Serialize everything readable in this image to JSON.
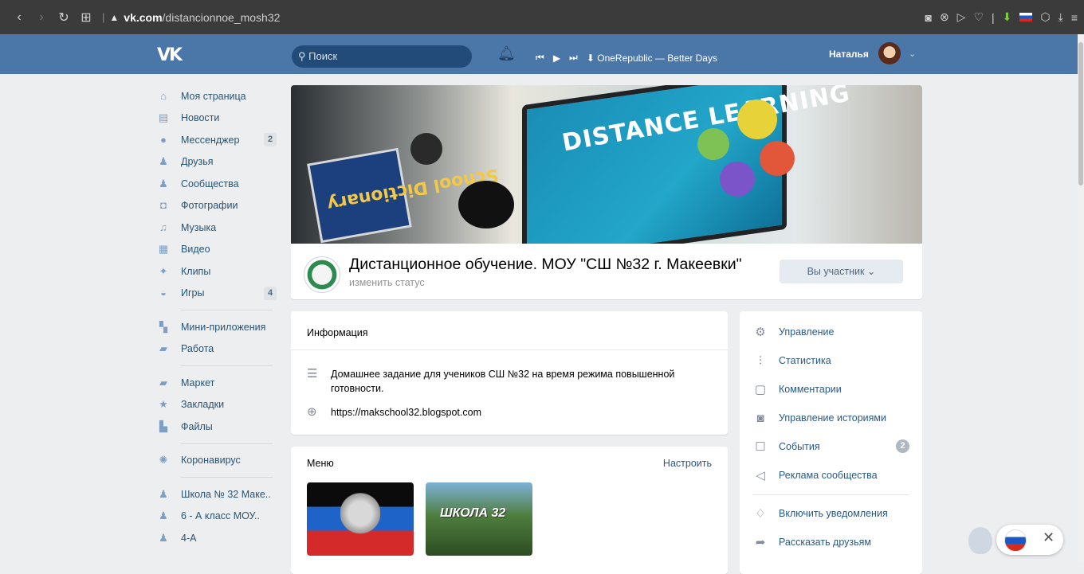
{
  "browser": {
    "url_domain": "vk.com",
    "url_path": "/distancionnoe_mosh32",
    "nav_back": "‹",
    "nav_forward": "›",
    "nav_reload": "↻",
    "nav_tabs": "⊞",
    "lock": "🔒"
  },
  "header": {
    "logo": "VK",
    "search_placeholder": "Поиск",
    "player_track": "OneRepublic — Better Days",
    "user_name": "Наталья"
  },
  "sidebar": {
    "items": [
      {
        "label": "Моя страница",
        "icon": "home-icon",
        "glyph": "⌂"
      },
      {
        "label": "Новости",
        "icon": "news-icon",
        "glyph": "▤"
      },
      {
        "label": "Мессенджер",
        "icon": "messenger-icon",
        "glyph": "●",
        "count": "2"
      },
      {
        "label": "Друзья",
        "icon": "friends-icon",
        "glyph": "♟"
      },
      {
        "label": "Сообщества",
        "icon": "communities-icon",
        "glyph": "♟"
      },
      {
        "label": "Фотографии",
        "icon": "photos-icon",
        "glyph": "◘"
      },
      {
        "label": "Музыка",
        "icon": "music-icon",
        "glyph": "♫"
      },
      {
        "label": "Видео",
        "icon": "video-icon",
        "glyph": "▦"
      },
      {
        "label": "Клипы",
        "icon": "clips-icon",
        "glyph": "✦"
      },
      {
        "label": "Игры",
        "icon": "games-icon",
        "glyph": "◒",
        "count": "4"
      }
    ],
    "items2": [
      {
        "label": "Мини-приложения",
        "icon": "mini-apps-icon",
        "glyph": "▚"
      },
      {
        "label": "Работа",
        "icon": "work-icon",
        "glyph": "▰"
      }
    ],
    "items3": [
      {
        "label": "Маркет",
        "icon": "market-icon",
        "glyph": "▰"
      },
      {
        "label": "Закладки",
        "icon": "bookmarks-icon",
        "glyph": "★"
      },
      {
        "label": "Файлы",
        "icon": "files-icon",
        "glyph": "▙"
      }
    ],
    "items4": [
      {
        "label": "Коронавирус",
        "icon": "coronavirus-icon",
        "glyph": "✺"
      }
    ],
    "items5": [
      {
        "label": "Школа № 32 Маке..",
        "icon": "group-icon",
        "glyph": "♟"
      },
      {
        "label": "6 - А класс МОУ..",
        "icon": "group-icon",
        "glyph": "♟"
      },
      {
        "label": "4-А",
        "icon": "group-icon",
        "glyph": "♟"
      }
    ]
  },
  "group": {
    "cover_title": "DISTANCE LEARNING",
    "cover_book": "School Dictionary",
    "name": "Дистанционное обучение. МОУ \"СШ №32 г. Макеевки\"",
    "status": "изменить статус",
    "member_button": "Вы участник ⌄"
  },
  "info": {
    "title": "Информация",
    "description": "Домашнее задание для учеников СШ №32 на время режима повышенной готовности.",
    "link": "https://makschool32.blogspot.com"
  },
  "menu": {
    "title": "Меню",
    "configure": "Настроить",
    "tile2_label": "ШКОЛА 32"
  },
  "actions": {
    "items": [
      {
        "label": "Управление",
        "icon": "settings-icon",
        "glyph": "⚙"
      },
      {
        "label": "Статистика",
        "icon": "statistics-icon",
        "glyph": "⫶"
      },
      {
        "label": "Комментарии",
        "icon": "comments-icon",
        "glyph": "▢"
      },
      {
        "label": "Управление историями",
        "icon": "stories-icon",
        "glyph": "◙"
      },
      {
        "label": "События",
        "icon": "events-icon",
        "glyph": "☐",
        "count": "2"
      },
      {
        "label": "Реклама сообщества",
        "icon": "ads-icon",
        "glyph": "◁"
      },
      {
        "label": "Включить уведомления",
        "icon": "bell-icon",
        "glyph": "♢"
      },
      {
        "label": "Рассказать друзьям",
        "icon": "share-icon",
        "glyph": "➦"
      }
    ]
  },
  "colors": {
    "vk_blue": "#4a76a8",
    "page_bg": "#edeef0",
    "link": "#2a5885"
  }
}
